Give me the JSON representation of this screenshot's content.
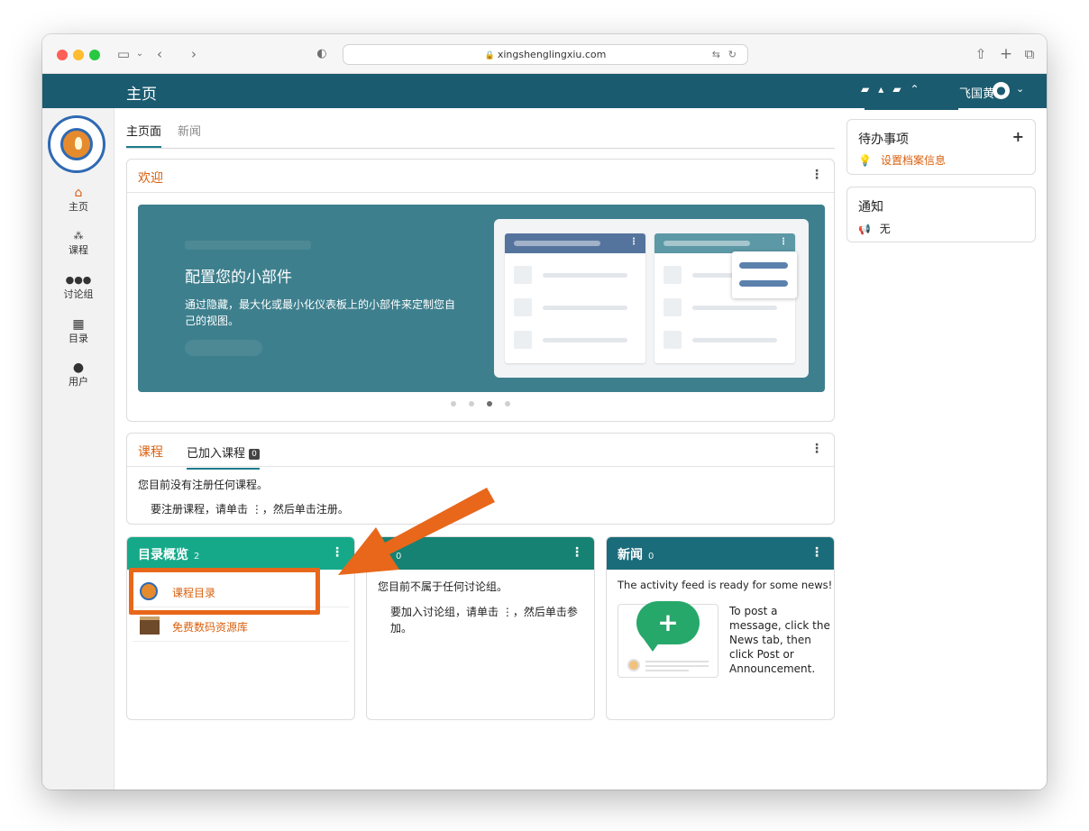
{
  "browser": {
    "url": "xingshenglingxiu.com"
  },
  "header": {
    "title": "主页",
    "username": "飞国黄"
  },
  "sidebar": {
    "items": [
      {
        "label": "主页"
      },
      {
        "label": "课程"
      },
      {
        "label": "讨论组"
      },
      {
        "label": "目录"
      },
      {
        "label": "用户"
      }
    ]
  },
  "main_tabs": [
    "主页面",
    "新闻"
  ],
  "welcome": {
    "title": "欢迎",
    "banner_title": "配置您的小部件",
    "banner_desc": "通过隐藏，最大化或最小化仪表板上的小部件来定制您自己的视图。"
  },
  "courses": {
    "title": "课程",
    "tab_label": "已加入课程",
    "tab_count": "0",
    "message": "您目前没有注册任何课程。",
    "hint": "要注册课程，请单击 ⋮，然后单击注册。"
  },
  "catalog": {
    "title": "目录概览",
    "count": "2",
    "items": [
      {
        "label": "课程目录"
      },
      {
        "label": "免费数码资源库"
      }
    ]
  },
  "groups": {
    "title": "讨论组",
    "visible_title": "组",
    "count": "0",
    "message": "您目前不属于任何讨论组。",
    "hint": "要加入讨论组，请单击 ⋮，然后单击参加。"
  },
  "news": {
    "title": "新闻",
    "count": "0",
    "message": "The activity feed is ready for some news!",
    "hint": "To post a message, click the News tab, then click Post or Announcement."
  },
  "todo": {
    "title": "待办事项",
    "item": "设置档案信息"
  },
  "notifications": {
    "title": "通知",
    "item": "无"
  },
  "colors": {
    "header": "#1b5b70",
    "accent": "#d9600f",
    "catalog_header": "#15a98a",
    "groups_header": "#168273",
    "news_header": "#1b6c7a",
    "annotation": "#e8671b"
  }
}
